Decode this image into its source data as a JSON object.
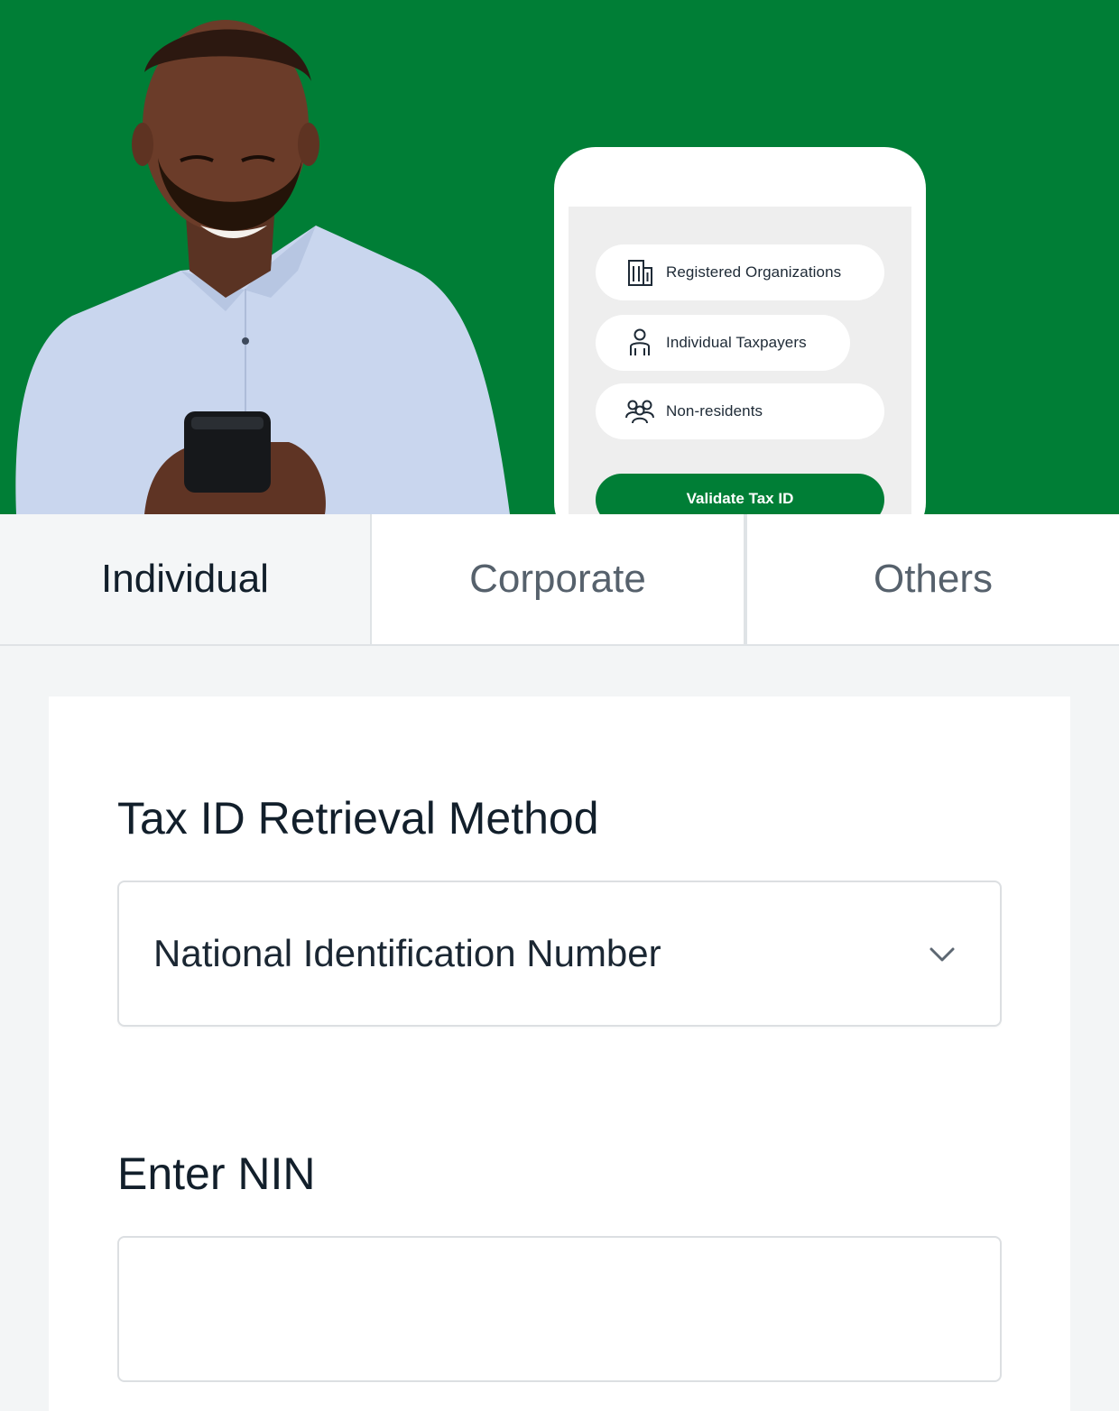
{
  "hero": {
    "background_color": "#007e36",
    "person_image": "person-holding-smartphone",
    "phone_card": {
      "options": [
        {
          "label": "Registered Organizations",
          "icon": "building-icon"
        },
        {
          "label": "Individual Taxpayers",
          "icon": "person-icon"
        },
        {
          "label": "Non-residents",
          "icon": "group-icon"
        }
      ],
      "button_label": "Validate Tax ID"
    }
  },
  "tabs": [
    {
      "label": "Individual",
      "active": true
    },
    {
      "label": "Corporate",
      "active": false
    },
    {
      "label": "Others",
      "active": false
    }
  ],
  "form": {
    "method_label": "Tax ID Retrieval Method",
    "method_selected": "National Identification Number",
    "nin_label": "Enter NIN",
    "nin_value": "",
    "nin_placeholder": ""
  },
  "colors": {
    "brand_green": "#007e36",
    "text_dark": "#121f2b",
    "tab_inactive_text": "#56616c"
  }
}
